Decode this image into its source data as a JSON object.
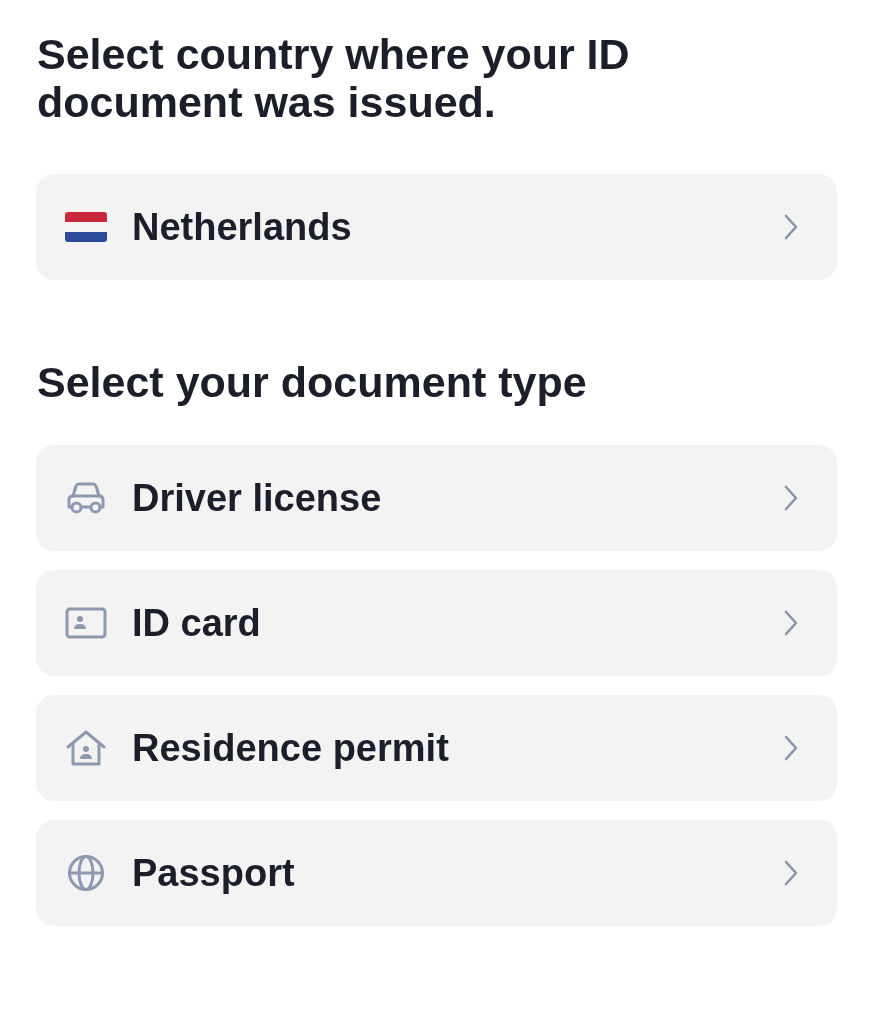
{
  "country_section": {
    "title": "Select country where your ID document was issued.",
    "country": {
      "label": "Netherlands"
    }
  },
  "document_section": {
    "title": "Select your document type",
    "items": [
      {
        "kind": "vehicle",
        "label": "Driver license"
      },
      {
        "kind": "card",
        "label": "ID card"
      },
      {
        "kind": "home",
        "label": "Residence permit"
      },
      {
        "kind": "globe",
        "label": "Passport"
      }
    ]
  }
}
